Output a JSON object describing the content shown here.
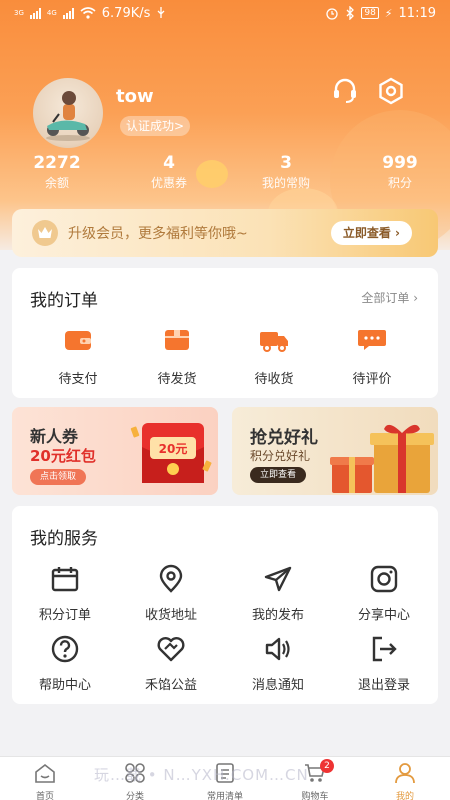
{
  "status_bar": {
    "network_left": "3G",
    "network_right": "4G",
    "speed": "6.79K/s",
    "battery": "98",
    "time": "11:19"
  },
  "profile": {
    "username": "tow",
    "verify_status": "认证成功>"
  },
  "stats": [
    {
      "value": "2272",
      "label": "余额"
    },
    {
      "value": "4",
      "label": "优惠券"
    },
    {
      "value": "3",
      "label": "我的常购"
    },
    {
      "value": "999",
      "label": "积分"
    }
  ],
  "vip": {
    "text": "升级会员，更多福利等你哦~",
    "button": "立即查看 ›"
  },
  "orders": {
    "title": "我的订单",
    "all_link": "全部订单 ›",
    "items": [
      {
        "label": "待支付",
        "icon": "wallet-icon"
      },
      {
        "label": "待发货",
        "icon": "package-icon"
      },
      {
        "label": "待收货",
        "icon": "truck-icon"
      },
      {
        "label": "待评价",
        "icon": "comment-icon"
      }
    ]
  },
  "promos": [
    {
      "title": "新人券",
      "subtitle": "20元红包",
      "button": "点击领取",
      "envelope_text": "20元"
    },
    {
      "title": "抢兑好礼",
      "subtitle": "积分兑好礼",
      "button": "立即查看"
    }
  ],
  "services": {
    "title": "我的服务",
    "items": [
      {
        "label": "积分订单",
        "icon": "calendar-icon"
      },
      {
        "label": "收货地址",
        "icon": "location-icon"
      },
      {
        "label": "我的发布",
        "icon": "send-icon"
      },
      {
        "label": "分享中心",
        "icon": "camera-icon"
      },
      {
        "label": "帮助中心",
        "icon": "help-icon"
      },
      {
        "label": "禾馅公益",
        "icon": "heart-icon"
      },
      {
        "label": "消息通知",
        "icon": "speaker-icon"
      },
      {
        "label": "退出登录",
        "icon": "logout-icon"
      }
    ]
  },
  "tabbar": {
    "items": [
      {
        "label": "首页",
        "icon": "home-icon"
      },
      {
        "label": "分类",
        "icon": "category-icon"
      },
      {
        "label": "常用清单",
        "icon": "list-icon"
      },
      {
        "label": "购物车",
        "icon": "cart-icon"
      },
      {
        "label": "我的",
        "icon": "user-icon"
      }
    ],
    "cart_badge": "2",
    "active": "我的"
  },
  "watermark": "玩…载 • N…YXH.COM…CN",
  "colors": {
    "accent": "#f98d3c",
    "order_icon": "#f5752e",
    "active_tab": "#e39a3f",
    "badge": "#ee3333"
  }
}
